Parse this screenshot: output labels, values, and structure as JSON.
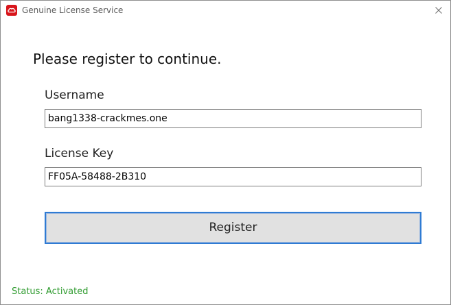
{
  "window": {
    "title": "Genuine License Service",
    "app_icon": "adobe-creative-cloud-icon",
    "close_icon": "close-icon"
  },
  "form": {
    "heading": "Please register to continue.",
    "username_label": "Username",
    "username_value": "bang1338-crackmes.one",
    "license_label": "License Key",
    "license_value": "FF05A-58488-2B310",
    "register_label": "Register"
  },
  "status": {
    "text": "Status: Activated",
    "color": "#2d9a2d"
  },
  "colors": {
    "accent": "#2f7bd3",
    "brand": "#d8151b"
  }
}
